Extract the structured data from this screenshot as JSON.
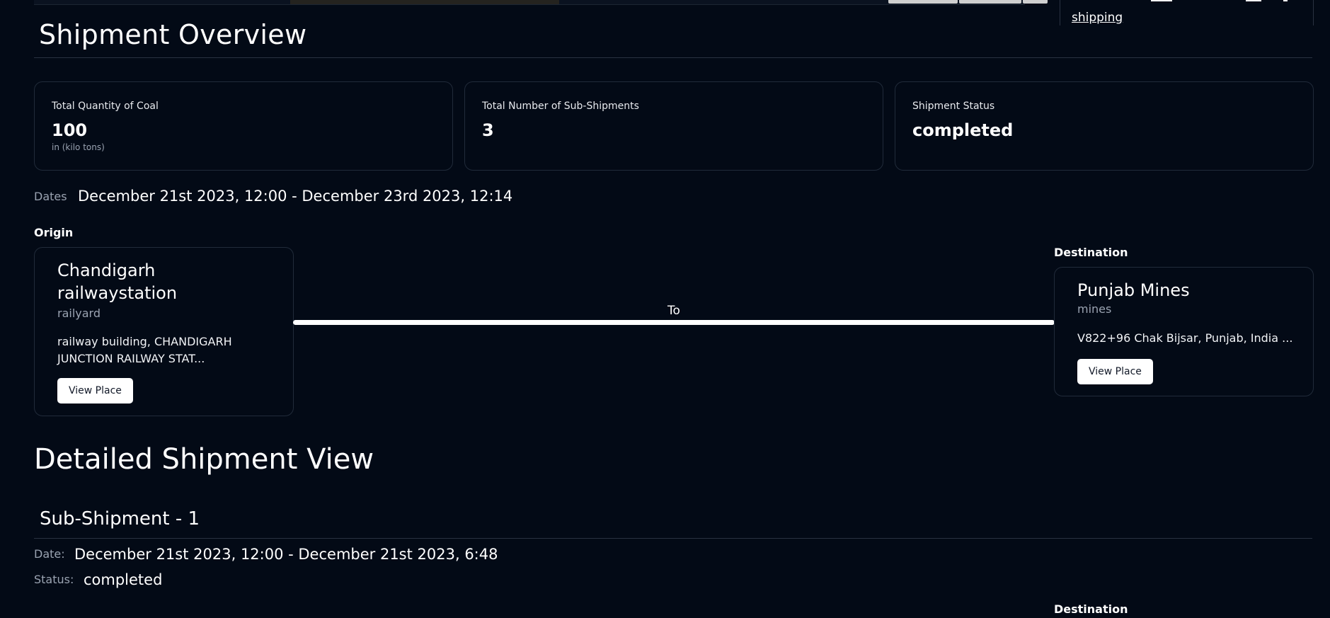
{
  "top": {
    "side_link": "shipping"
  },
  "overview": {
    "title": "Shipment Overview",
    "stats": [
      {
        "label": "Total Quantity of Coal",
        "value": "100",
        "sub": "in (kilo tons)"
      },
      {
        "label": "Total Number of Sub-Shipments",
        "value": "3"
      },
      {
        "label": "Shipment Status",
        "value": "completed"
      }
    ],
    "dates_label": "Dates",
    "dates_value": "December 21st 2023, 12:00 - December 23rd 2023, 12:14",
    "origin": {
      "section_label": "Origin",
      "name_line1": "Chandigarh",
      "name_line2": "railwaystation",
      "type": "railyard",
      "address_line1": "railway building, CHANDIGARH",
      "address_line2": "JUNCTION RAILWAY STAT...",
      "button": "View Place"
    },
    "route_label": "To",
    "destination": {
      "section_label": "Destination",
      "name": "Punjab Mines",
      "type": "mines",
      "address": "V822+96 Chak Bijsar, Punjab, India ...",
      "button": "View Place"
    }
  },
  "detailed": {
    "title": "Detailed Shipment View",
    "sub_shipment": {
      "title": "Sub-Shipment - 1",
      "date_label": "Date:",
      "date_value": "December 21st 2023, 12:00 - December 21st 2023, 6:48",
      "status_label": "Status:",
      "status_value": "completed",
      "destination_label": "Destination"
    }
  }
}
